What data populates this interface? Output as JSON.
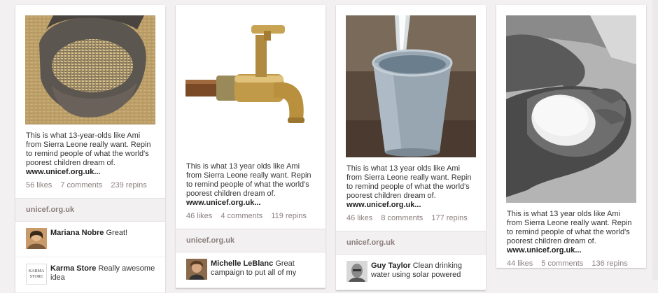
{
  "pins": [
    {
      "image": "hands-holding-grain-image",
      "desc": "This is what 13-year-olds like Ami from Sierra Leone really want. Repin to remind people of what the world's poorest children dream of.",
      "link": "www.unicef.org.uk...",
      "likes": "56 likes",
      "comments": "7 comments",
      "repins": "239 repins",
      "source": "unicef.org.uk",
      "comment_list": [
        {
          "name": "Mariana Nobre",
          "text": "Great!"
        },
        {
          "name": "Karma Store",
          "text": "Really awesome idea",
          "avatar_text": "KARMA STORE"
        }
      ]
    },
    {
      "image": "brass-tap-image",
      "desc": "This is what 13 year olds like Ami from Sierra Leone really want. Repin to remind people of what the world's poorest children dream of.",
      "link": "www.unicef.org.uk...",
      "likes": "46 likes",
      "comments": "4 comments",
      "repins": "119 repins",
      "source": "unicef.org.uk",
      "comment_list": [
        {
          "name": "Michelle LeBlanc",
          "text": "Great campaign to put all of my"
        }
      ]
    },
    {
      "image": "water-bucket-image",
      "desc": "This is what 13 year olds like Ami from Sierra Leone really want. Repin to remind people of what the world's poorest children dream of.",
      "link": "www.unicef.org.uk...",
      "likes": "46 likes",
      "comments": "8 comments",
      "repins": "177 repins",
      "source": "unicef.org.uk",
      "comment_list": [
        {
          "name": "Guy Taylor",
          "text": "Clean drinking water using solar powered"
        }
      ]
    },
    {
      "image": "hands-holding-soap-image",
      "desc": "This is what 13 year olds like Ami from Sierra Leone really want. Repin to remind people of what the world's poorest children dream of.",
      "link": "www.unicef.org.uk...",
      "likes": "44 likes",
      "comments": "5 comments",
      "repins": "136 repins"
    }
  ]
}
